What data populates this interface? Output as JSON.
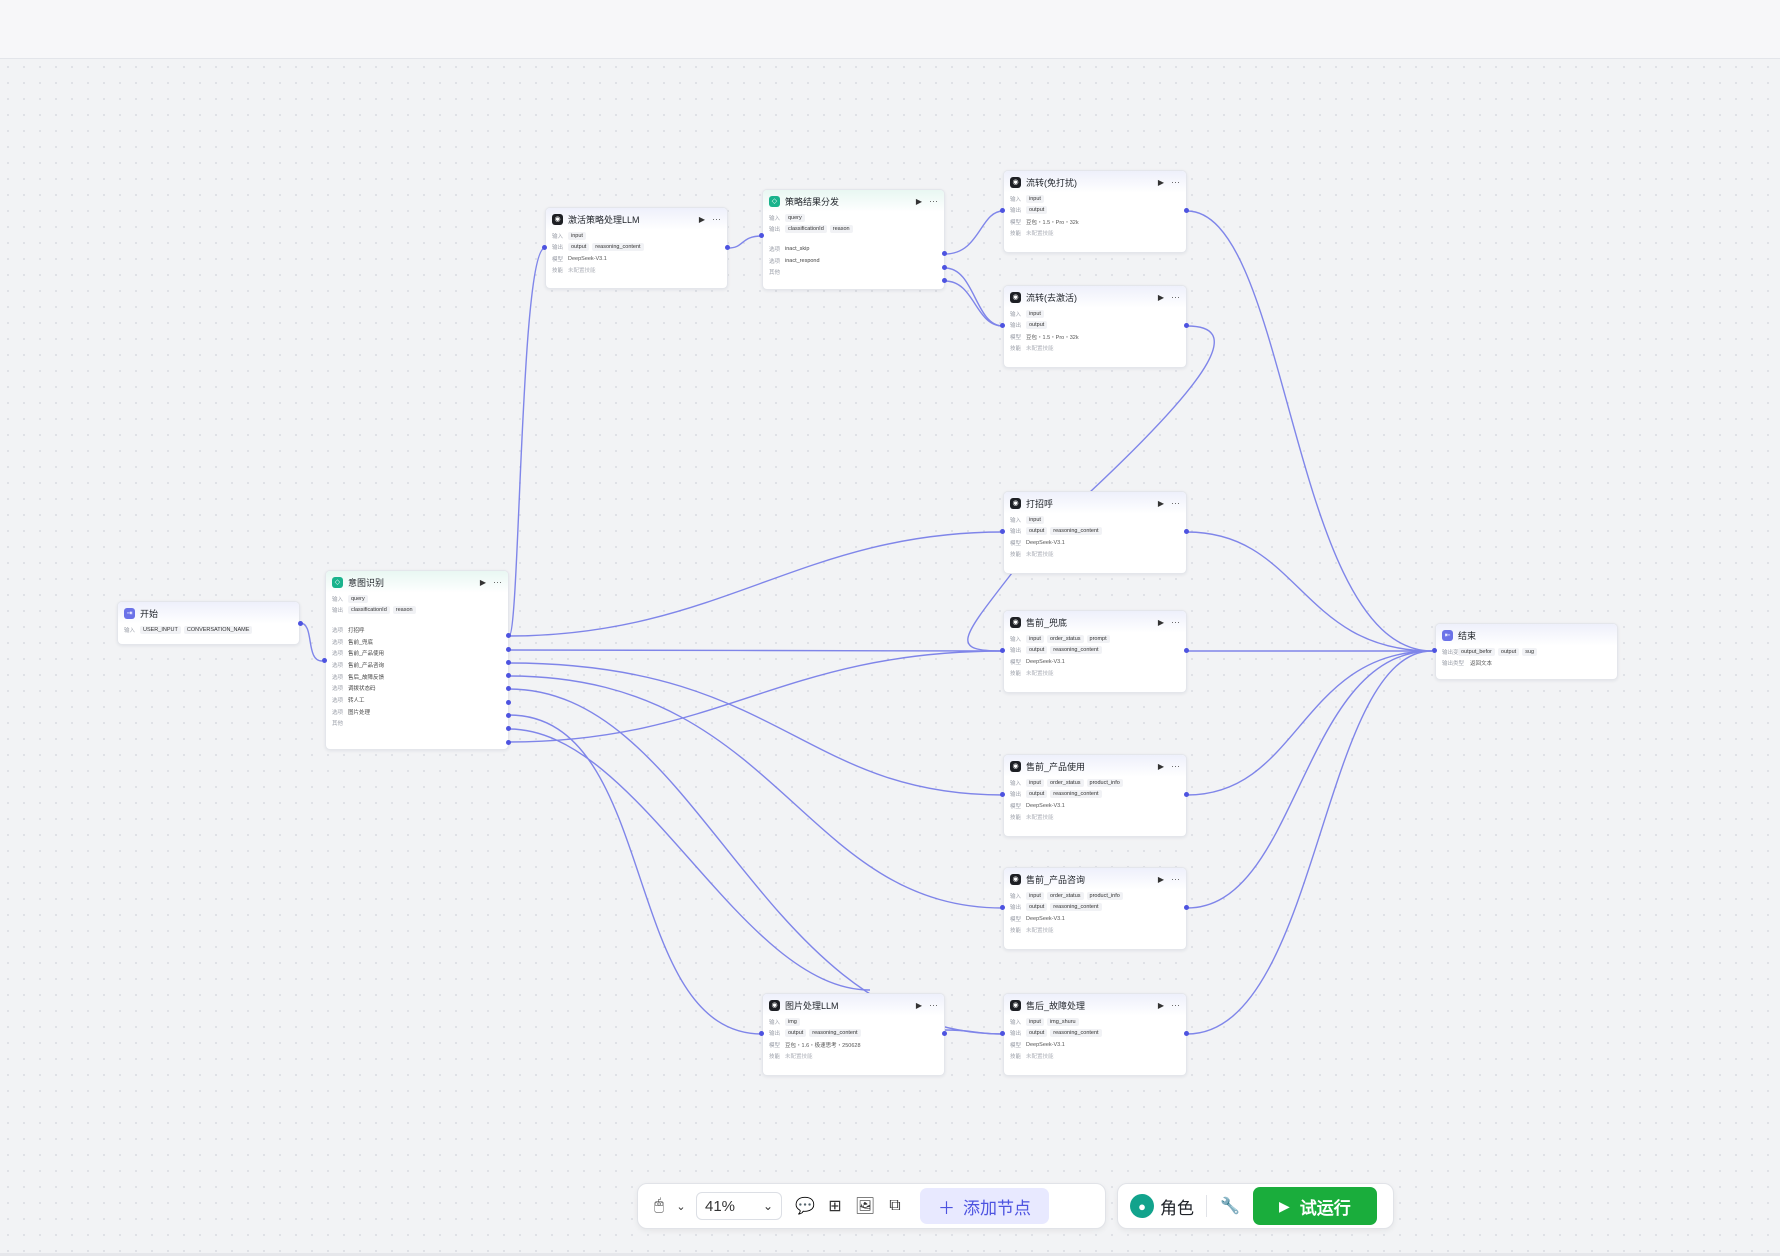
{
  "toolbar": {
    "zoom": "41%",
    "add_node_label": "添加节点",
    "add_node_icon": "＋",
    "role_label": "角色",
    "run_label": "试运行",
    "run_icon": "▶"
  },
  "labels": {
    "input": "输入",
    "output": "输出",
    "model": "模型",
    "skill": "技能",
    "option": "选项",
    "other": "其他",
    "output_var": "输出变量",
    "answer_type": "输出类型"
  },
  "nodes": {
    "start": {
      "title": "开始",
      "inputs": [
        "USER_INPUT",
        "CONVERSATION_NAME"
      ]
    },
    "intent": {
      "title": "意图识别",
      "inputs": [
        "query"
      ],
      "outputs": [
        "classificationId",
        "reason"
      ],
      "options": [
        "打招呼",
        "售前_兜底",
        "售前_产品使用",
        "售前_产品咨询",
        "售后_故障反馈",
        "调拨状态码",
        "转人工",
        "图片处理"
      ]
    },
    "activate_llm": {
      "title": "激活策略处理LLM",
      "inputs": [
        "input"
      ],
      "outputs": [
        "output",
        "reasoning_content"
      ],
      "model": "DeepSeek-V3.1",
      "skill": "未配置技能"
    },
    "strategy": {
      "title": "策略结果分发",
      "inputs": [
        "query"
      ],
      "outputs": [
        "classificationId",
        "reason"
      ],
      "options": [
        "inact_skip",
        "inact_respond"
      ]
    },
    "flow_no_disturb": {
      "title": "流转(免打扰)",
      "inputs": [
        "input"
      ],
      "outputs": [
        "output"
      ],
      "model": "豆包・1.5・Pro・32k",
      "skill": "未配置技能"
    },
    "flow_deactivate": {
      "title": "流转(去激活)",
      "inputs": [
        "input"
      ],
      "outputs": [
        "output"
      ],
      "model": "豆包・1.5・Pro・32k",
      "skill": "未配置技能"
    },
    "greet": {
      "title": "打招呼",
      "inputs": [
        "input"
      ],
      "outputs": [
        "output",
        "reasoning_content"
      ],
      "model": "DeepSeek-V3.1",
      "skill": "未配置技能"
    },
    "presale_fallback": {
      "title": "售前_兜底",
      "inputs": [
        "input",
        "order_status",
        "prompt"
      ],
      "outputs": [
        "output",
        "reasoning_content"
      ],
      "model": "DeepSeek-V3.1",
      "skill": "未配置技能"
    },
    "presale_usage": {
      "title": "售前_产品使用",
      "inputs": [
        "input",
        "order_status",
        "product_info"
      ],
      "outputs": [
        "output",
        "reasoning_content"
      ],
      "model": "DeepSeek-V3.1",
      "skill": "未配置技能"
    },
    "presale_consult": {
      "title": "售前_产品咨询",
      "inputs": [
        "input",
        "order_status",
        "product_info"
      ],
      "outputs": [
        "output",
        "reasoning_content"
      ],
      "model": "DeepSeek-V3.1",
      "skill": "未配置技能"
    },
    "image_llm": {
      "title": "图片处理LLM",
      "inputs": [
        "img"
      ],
      "outputs": [
        "output",
        "reasoning_content"
      ],
      "model": "豆包・1.6・极速思考・250628",
      "skill": "未配置技能"
    },
    "aftersale_fault": {
      "title": "售后_故障处理",
      "inputs": [
        "input",
        "img_shuru"
      ],
      "outputs": [
        "output",
        "reasoning_content"
      ],
      "model": "DeepSeek-V3.1",
      "skill": "未配置技能"
    },
    "end": {
      "title": "结束",
      "outputs": [
        "output_befor",
        "output",
        "sug"
      ],
      "answer_type": "返回文本"
    }
  },
  "colors": {
    "edge": "#6b72e8",
    "port": "#4d53e0",
    "run_button": "#1aad3c",
    "add_button_bg": "#e8e9ff"
  }
}
